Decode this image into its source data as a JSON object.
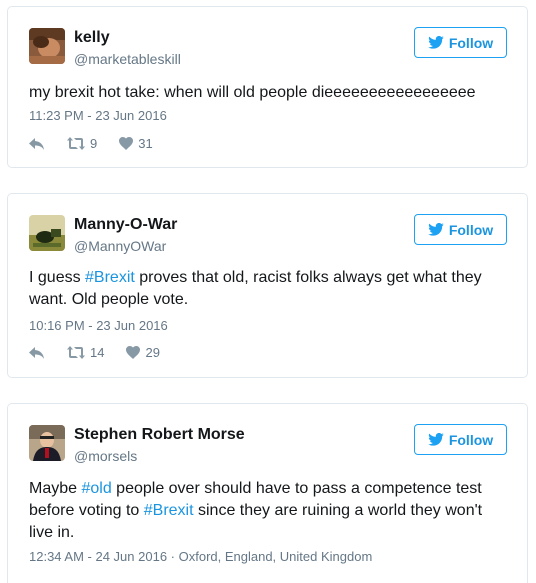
{
  "follow_label": "Follow",
  "tweets": [
    {
      "name": "kelly",
      "handle": "@marketableskill",
      "text": "my brexit hot take: when will old people dieeeeeeeeeeeeeeeee",
      "timestamp": "11:23 PM - 23 Jun 2016",
      "retweets": "9",
      "likes": "31"
    },
    {
      "name": "Manny-O-War",
      "handle": "@MannyOWar",
      "text_pre": "I guess ",
      "hashtag": "#Brexit",
      "text_post": " proves that old, racist folks always get what they want. Old people vote.",
      "timestamp": "10:16 PM - 23 Jun 2016",
      "retweets": "14",
      "likes": "29"
    },
    {
      "name": "Stephen Robert Morse",
      "handle": "@morsels",
      "text_a": "Maybe ",
      "hashtag1": "#old",
      "text_b": " people over should have to pass a competence test before voting to ",
      "hashtag2": "#Brexit",
      "text_c": " since they are ruining a world they won't live in.",
      "timestamp": "12:34 AM - 24 Jun 2016",
      "location": "Oxford, England, United Kingdom"
    }
  ],
  "colors": {
    "accent": "#1da1f2",
    "link": "#1b95e0",
    "secondary_text": "#657786",
    "border": "#e1e8ed"
  },
  "icons": [
    "twitter-bird-icon",
    "reply-icon",
    "retweet-icon",
    "heart-icon"
  ]
}
